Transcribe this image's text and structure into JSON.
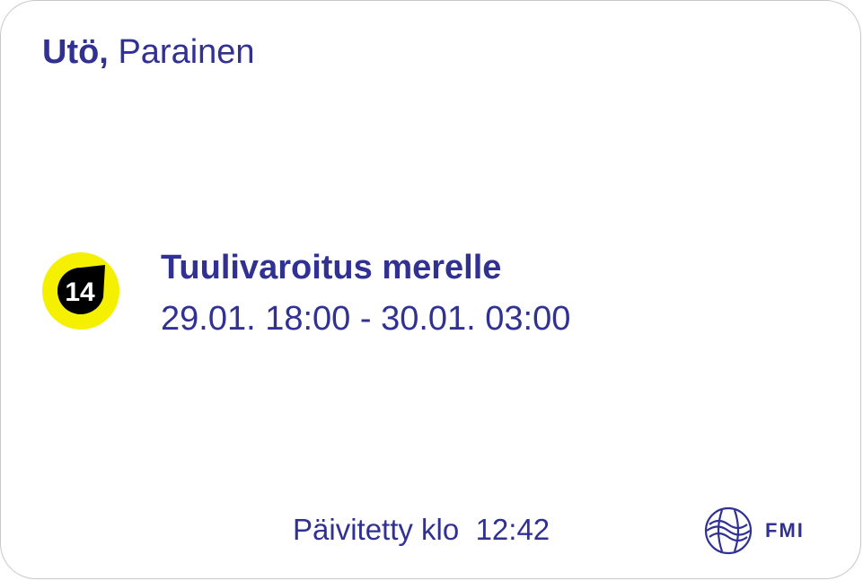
{
  "location": {
    "place": "Utö,",
    "municipality": "Parainen"
  },
  "warning": {
    "badge_value": "14",
    "badge_color": "#f5f000",
    "icon": "wind-warning-icon",
    "title": "Tuulivaroitus merelle",
    "time_range": "29.01. 18:00 - 30.01. 03:00"
  },
  "footer": {
    "updated_label": "Päivitetty klo  12:42",
    "logo_text": "FMI"
  },
  "colors": {
    "text": "#303193",
    "badge_yellow": "#f5f000",
    "badge_black": "#000000"
  }
}
